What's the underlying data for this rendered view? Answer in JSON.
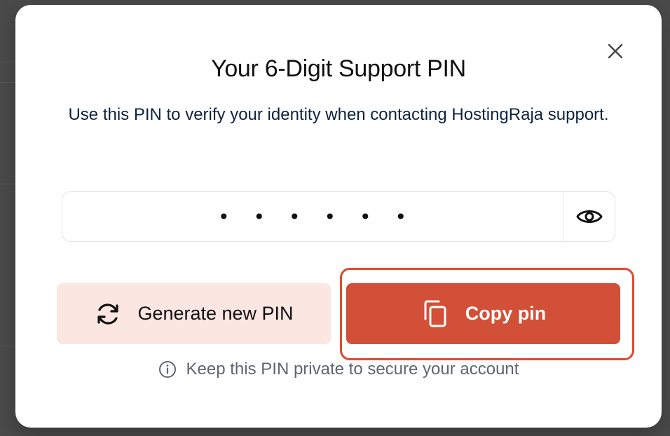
{
  "modal": {
    "title": "Your 6-Digit Support PIN",
    "description": "Use this PIN to verify your identity when contacting HostingRaja support.",
    "pin": {
      "masked_value": "••••••",
      "digits": 6,
      "visibility_icon": "eye-icon"
    },
    "buttons": {
      "generate_label": "Generate new PIN",
      "generate_icon": "refresh-icon",
      "copy_label": "Copy pin",
      "copy_icon": "copy-icon"
    },
    "hint": {
      "icon": "info-icon",
      "text": "Keep this PIN private to secure your account"
    },
    "close_icon": "close-icon"
  },
  "colors": {
    "primary": "#d24f38",
    "primary_soft": "#fbe6e1",
    "focus_ring": "#e04a2f",
    "heading_text": "#111111",
    "body_text": "#0d2340",
    "muted_text": "#5f6670"
  }
}
